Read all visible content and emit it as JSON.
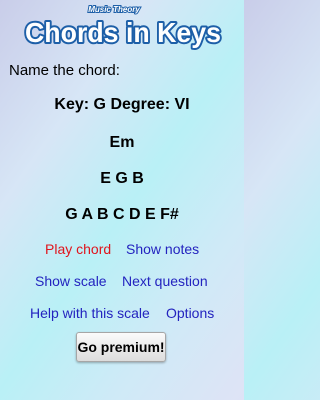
{
  "header": {
    "subtitle": "Music Theory",
    "title": "Chords in Keys"
  },
  "prompt": "Name the chord:",
  "question": {
    "key_line": "Key: G  Degree: VI",
    "chord": "Em",
    "chord_notes": "E G B",
    "scale_notes": "G A B C D E F#"
  },
  "actions": {
    "play_chord": "Play chord",
    "show_notes": "Show notes",
    "show_scale": "Show scale",
    "next_question": "Next question",
    "help_scale": "Help with this scale",
    "options": "Options",
    "premium": "Go premium!"
  },
  "colors": {
    "active_link": "#e0141c",
    "link": "#2323bf",
    "title_fill": "#ffffff",
    "title_outline": "#1d5fa8"
  }
}
